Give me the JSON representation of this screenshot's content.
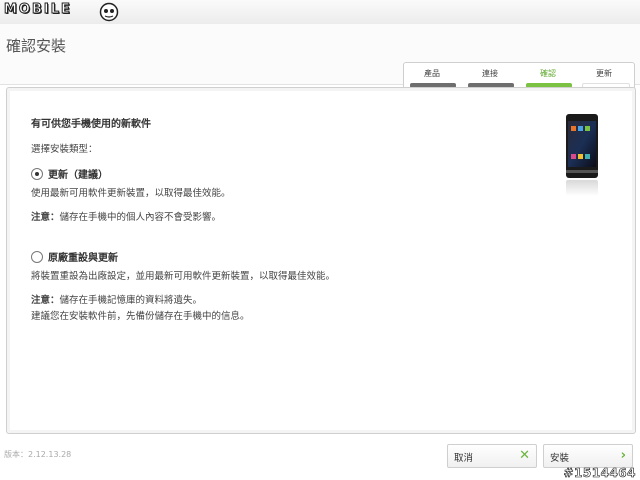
{
  "branding": {
    "logo_text": "MOBILE"
  },
  "page": {
    "title": "確認安裝"
  },
  "steps": [
    {
      "label": "產品",
      "state": "done"
    },
    {
      "label": "連接",
      "state": "done"
    },
    {
      "label": "確認",
      "state": "active"
    },
    {
      "label": "更新",
      "state": "pending"
    }
  ],
  "main": {
    "heading": "有可供您手機使用的新軟件",
    "prompt": "選擇安裝類型：",
    "option_update": {
      "label": "更新（建議）",
      "selected": true,
      "description": "使用最新可用軟件更新裝置，以取得最佳效能。",
      "note_prefix": "注意：",
      "note_text": "儲存在手機中的個人內容不會受影響。"
    },
    "option_reset": {
      "label": "原廠重設與更新",
      "selected": false,
      "description": "將裝置重設為出廠設定，並用最新可用軟件更新裝置，以取得最佳效能。",
      "note_prefix": "注意：",
      "note_text": "儲存在手機記憶庫的資料將遺失。",
      "note_line2": "建議您在安裝軟件前，先備份儲存在手機中的信息。"
    }
  },
  "footer": {
    "version": "版本：2.12.13.28",
    "cancel_label": "取消",
    "install_label": "安裝"
  },
  "watermark": "#1514464",
  "colors": {
    "accent": "#7cc242",
    "done_bar": "#6e6e6e"
  }
}
